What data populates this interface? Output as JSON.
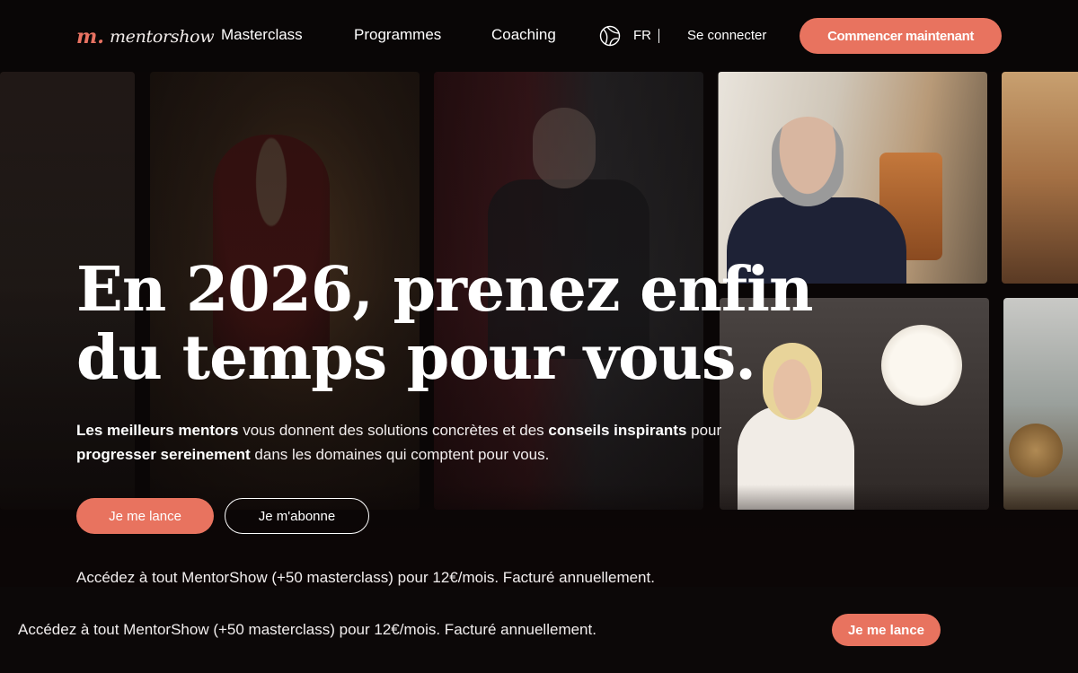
{
  "brand": {
    "logo_mark": "m.",
    "name": "mentorshow",
    "accent_color": "#e8735f"
  },
  "nav": {
    "items": [
      {
        "label": "Masterclass"
      },
      {
        "label": "Programmes"
      },
      {
        "label": "Coaching"
      }
    ],
    "language": {
      "icon": "globe-icon",
      "label": "FR"
    },
    "login_label": "Se connecter",
    "cta_label": "Commencer maintenant"
  },
  "hero": {
    "title_line1": "En 2026, prenez enfin",
    "title_line2": "du temps pour vous.",
    "description": {
      "part1": "Les meilleurs mentors",
      "part2": " vous donnent des solutions concrètes et des ",
      "part3": "conseils inspirants",
      "part4": " pour ",
      "part5": "progresser sereinement",
      "part6": " dans les domaines qui comptent pour vous."
    },
    "primary_button": "Je me lance",
    "secondary_button": "Je m'abonne",
    "note": "Accédez à tout MentorShow (+50 masterclass) pour 12€/mois. Facturé annuellement."
  },
  "bottom_bar": {
    "text": "Accédez à tout MentorShow (+50 masterclass) pour 12€/mois. Facturé annuellement.",
    "cta_label": "Je me lance"
  }
}
